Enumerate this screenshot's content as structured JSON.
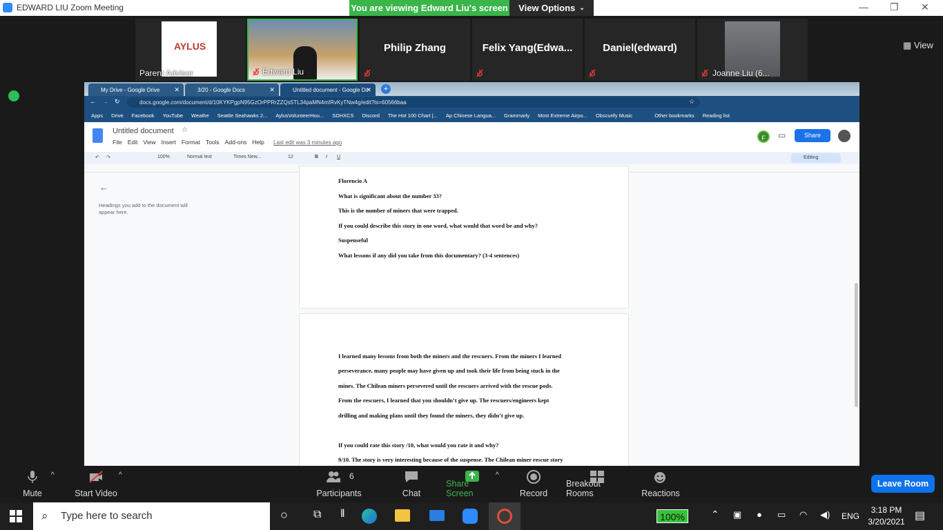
{
  "zoom": {
    "window_title": "EDWARD LIU   Zoom Meeting",
    "viewing_banner": "You are viewing Edward Liu's screen",
    "view_options": "View Options",
    "view_button": "View",
    "participants": [
      {
        "name": "Parent Advisor",
        "type": "image"
      },
      {
        "name": "Edward Liu",
        "type": "video"
      },
      {
        "name": "Philip Zhang",
        "type": "text"
      },
      {
        "name": "Felix  Yang(Edwa...",
        "type": "text"
      },
      {
        "name": "Daniel(edward)",
        "type": "text"
      },
      {
        "name": "Joanne Liu (6...",
        "type": "image"
      }
    ],
    "controls": {
      "mute": "Mute",
      "start_video": "Start Video",
      "participants_count": "6",
      "participants": "Participants",
      "chat": "Chat",
      "share_screen": "Share Screen",
      "record": "Record",
      "breakout_rooms": "Breakout Rooms",
      "reactions": "Reactions",
      "leave_room": "Leave Room"
    }
  },
  "browser": {
    "tabs": [
      {
        "label": "My Drive - Google Drive",
        "active": false
      },
      {
        "label": "3/20 - Google Docs",
        "active": false
      },
      {
        "label": "Untitled document - Google Do",
        "active": true
      }
    ],
    "url": "docs.google.com/document/d/10KYKPgpN95GzOrPPRrZZQs5TL34paMN4mIRvKyTNw4g/edit?ts=60566baa",
    "bookmarks": [
      "Apps",
      "Drive",
      "Facebook",
      "YouTube",
      "Weathe",
      "Seattle Seahawks 2...",
      "AylusVolunteerHou...",
      "SDHXCS",
      "Discord",
      "The Hot 100 Chart |...",
      "Ap Chinese Langua...",
      "Grammarly",
      "Most Extreme Airpo...",
      "Obscurify Music",
      "Other bookmarks",
      "Reading list"
    ]
  },
  "docs": {
    "title": "Untitled document",
    "menu": [
      "File",
      "Edit",
      "View",
      "Insert",
      "Format",
      "Tools",
      "Add-ons",
      "Help"
    ],
    "last_edit": "Last edit was 3 minutes ago",
    "avatar_letter": "F",
    "share": "Share",
    "zoom": "100%",
    "style": "Normal text",
    "font": "Times New...",
    "font_size": "12",
    "mode": "Editing",
    "outline_note": "Headings you add to the document will appear here.",
    "page1_lines": [
      "Florencio A",
      "What is significant about the number 33?",
      "This is the number of miners that were trapped.",
      "If you could describe this story in one word, what would that word be and why?",
      "Suspenseful",
      "What lessons if any did you take from this documentary? (3-4 sentences)"
    ],
    "page2_lines": [
      "I learned many lessons from both the miners and the rescuers. From the miners I learned",
      "perseverance, many people may have given up and took their life from being stuck in the",
      "mines. The Chilean miners persevered until the rescuers arrived with the rescue pods.",
      "From the rescuers, I learned that you shouldn’t give up. The rescuers/engineers kept",
      "drilling and making plans until they found the miners, they didn’t give up.",
      " If you could rate this story /10, what would you rate it and why?",
      "9/10. The story is very interesting because of the suspense. The Chilean miner rescue story"
    ]
  },
  "taskbar": {
    "search_placeholder": "Type here to search",
    "battery": "100%",
    "language": "ENG",
    "time": "3:18 PM",
    "date": "3/20/2021"
  }
}
